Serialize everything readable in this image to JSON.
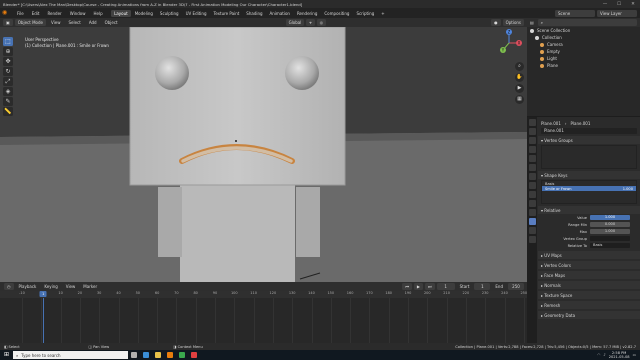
{
  "window": {
    "title": "Blender* [C:\\Users\\Alex The Man\\Desktop\\Course - Creating Animations from A-Z in Blender 3D\\7 - First Animation Modeling Our Character\\Character1.blend]",
    "minimize": "—",
    "maximize": "☐",
    "close": "✕"
  },
  "menubar": {
    "items": [
      "File",
      "Edit",
      "Render",
      "Window",
      "Help"
    ],
    "workspaces": [
      "Layout",
      "Modeling",
      "Sculpting",
      "UV Editing",
      "Texture Paint",
      "Shading",
      "Animation",
      "Rendering",
      "Compositing",
      "Scripting"
    ],
    "active_workspace": "Layout",
    "add_workspace": "+",
    "scene_label": "Scene",
    "view_layer_label": "View Layer"
  },
  "viewport_header": {
    "mode": "Object Mode",
    "menus": [
      "View",
      "Select",
      "Add",
      "Object"
    ],
    "transform": "Global",
    "options": "Options"
  },
  "viewport_info": {
    "line1": "User Perspective",
    "line2": "(1) Collection | Plane.001 : Smile or Frown"
  },
  "toolbar_icons": [
    "cursor-select-icon",
    "cursor-icon",
    "move-icon",
    "rotate-icon",
    "scale-icon",
    "transform-icon",
    "annotate-icon",
    "measure-icon"
  ],
  "toolbar_glyphs": [
    "⬚",
    "⊕",
    "✥",
    "↻",
    "⤢",
    "◈",
    "✎",
    "📏"
  ],
  "gizmo": {
    "x": "X",
    "y": "Y",
    "z": "Z"
  },
  "outliner": {
    "title": "Scene Collection",
    "rows": [
      {
        "label": "Scene Collection",
        "indent": 0,
        "color": "#d6d6d6",
        "selected": false
      },
      {
        "label": "Collection",
        "indent": 1,
        "color": "#d6d6d6",
        "selected": false
      },
      {
        "label": "Camera",
        "indent": 2,
        "color": "#e0a050",
        "selected": false
      },
      {
        "label": "Empty",
        "indent": 2,
        "color": "#e0a050",
        "selected": false
      },
      {
        "label": "Light",
        "indent": 2,
        "color": "#e0a050",
        "selected": false
      },
      {
        "label": "Plane",
        "indent": 2,
        "color": "#e0a050",
        "selected": false
      }
    ]
  },
  "properties": {
    "object_name": "Plane.001",
    "mesh_name": "Plane.001",
    "data_field": "Plane.001",
    "vertex_groups_label": "Vertex Groups",
    "shape_keys_label": "Shape Keys",
    "shape_keys": [
      {
        "name": "Basis",
        "value": "",
        "selected": false
      },
      {
        "name": "Smile or Frown",
        "value": "1.000",
        "selected": true
      }
    ],
    "relative_label": "Relative",
    "rows": [
      {
        "label": "Value",
        "value": "1.000",
        "style": "blue"
      },
      {
        "label": "Range Min",
        "value": "0.000",
        "style": ""
      },
      {
        "label": "Max",
        "value": "1.000",
        "style": ""
      },
      {
        "label": "Vertex Group",
        "value": "",
        "style": "dark"
      },
      {
        "label": "Relative To",
        "value": "Basis",
        "style": "dark"
      }
    ],
    "sections": [
      "UV Maps",
      "Vertex Colors",
      "Face Maps",
      "Normals",
      "Texture Space",
      "Remesh",
      "Geometry Data"
    ]
  },
  "timeline": {
    "menus": [
      "Playback",
      "Keying",
      "View",
      "Marker"
    ],
    "current_frame": "1",
    "start_label": "Start",
    "start": "1",
    "end_label": "End",
    "end": "250",
    "ticks": [
      "-10",
      "0",
      "10",
      "20",
      "30",
      "40",
      "50",
      "60",
      "70",
      "80",
      "90",
      "100",
      "110",
      "120",
      "130",
      "140",
      "150",
      "160",
      "170",
      "180",
      "190",
      "200",
      "210",
      "220",
      "230",
      "240",
      "250"
    ]
  },
  "status": {
    "left": "Select",
    "middle": "Pan View",
    "right": "Context Menu",
    "stats": "Collection | Plane.001 | Verts:2,788 | Faces:2,728 | Tris:5,456 | Objects:0/5 | Mem: 57.7 MiB | v2.82.7"
  },
  "taskbar": {
    "start_icon": "⊞",
    "search_placeholder": "Type here to search",
    "time": "2:58 PM",
    "date": "2021-05-08",
    "apps": [
      {
        "name": "task-view-icon",
        "color": "#b0b0b0"
      },
      {
        "name": "edge-icon",
        "color": "#3a8fd9"
      },
      {
        "name": "explorer-icon",
        "color": "#e8c24a"
      },
      {
        "name": "blender-icon",
        "color": "#e87d0d"
      },
      {
        "name": "camtasia-icon",
        "color": "#3aa84e"
      },
      {
        "name": "recorder-icon",
        "color": "#e04040"
      }
    ]
  },
  "colors": {
    "accent": "#4772b3",
    "blender_orange": "#e87d0d",
    "viewport_bg": "#3a3a3a",
    "char_body": "#c4c4c4"
  }
}
